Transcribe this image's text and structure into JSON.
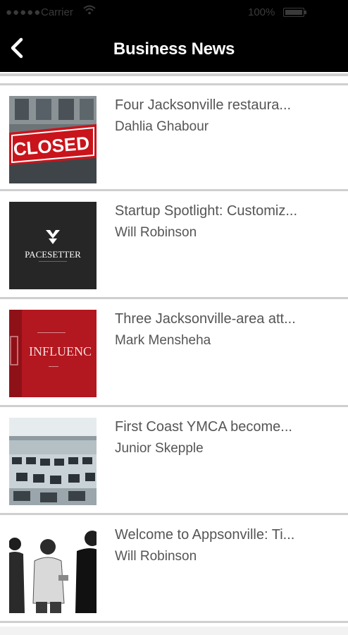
{
  "status_bar": {
    "carrier": "Carrier",
    "battery": "100%"
  },
  "header": {
    "title": "Business News"
  },
  "articles": [
    {
      "headline": "Four Jacksonville restaura...",
      "author": "Dahlia Ghabour",
      "thumb_text": "CLOSED",
      "thumb_icon": "closed-sign"
    },
    {
      "headline": "Startup Spotlight: Customiz...",
      "author": "Will Robinson",
      "thumb_text": "PACESETTER",
      "thumb_icon": "pacesetter-logo"
    },
    {
      "headline": "Three Jacksonville-area att...",
      "author": "Mark Mensheha",
      "thumb_text": "INFLUENC",
      "thumb_icon": "influence-logo"
    },
    {
      "headline": "First Coast YMCA become...",
      "author": "Junior Skepple",
      "thumb_icon": "office-photo"
    },
    {
      "headline": "Welcome to Appsonville: Ti...",
      "author": "Will Robinson",
      "thumb_icon": "people-photo"
    }
  ]
}
